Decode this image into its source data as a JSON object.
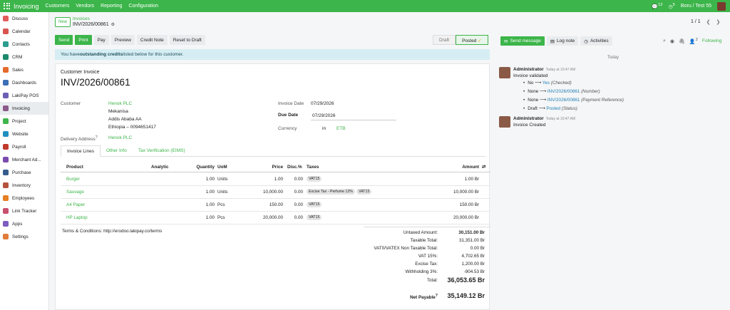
{
  "topbar": {
    "app_name": "Invoicing",
    "menus": [
      "Customers",
      "Vendors",
      "Reporting",
      "Configuration"
    ],
    "chat_count": "12",
    "activity_count": "5",
    "company": "Boru / Test 55"
  },
  "sidebar": {
    "items": [
      {
        "label": "Discuss",
        "color": "#e35c5c"
      },
      {
        "label": "Calendar",
        "color": "#d9534f"
      },
      {
        "label": "Contacts",
        "color": "#2a9d8f"
      },
      {
        "label": "CRM",
        "color": "#1b8a6b"
      },
      {
        "label": "Sales",
        "color": "#e46a2e"
      },
      {
        "label": "Dashboards",
        "color": "#3b6fb6"
      },
      {
        "label": "LakiPay POS",
        "color": "#6b5fb5"
      },
      {
        "label": "Invoicing",
        "color": "#8a5a8a",
        "active": true
      },
      {
        "label": "Project",
        "color": "#3cb54a"
      },
      {
        "label": "Website",
        "color": "#1f8fc0"
      },
      {
        "label": "Payroll",
        "color": "#c0392b"
      },
      {
        "label": "Merchant Ad...",
        "color": "#7b4bb0"
      },
      {
        "label": "Purchase",
        "color": "#355c8c"
      },
      {
        "label": "Inventory",
        "color": "#b5533c"
      },
      {
        "label": "Employees",
        "color": "#e67e22"
      },
      {
        "label": "Link Tracker",
        "color": "#c94f6d"
      },
      {
        "label": "Apps",
        "color": "#7c5cbf"
      },
      {
        "label": "Settings",
        "color": "#e07b39"
      }
    ]
  },
  "control_panel": {
    "new_label": "New",
    "breadcrumb_parent": "Invoices",
    "breadcrumb_current": "INV/2026/00861",
    "pager": "1 / 1"
  },
  "actions": [
    "Send",
    "Print",
    "Pay",
    "Preview",
    "Credit Note",
    "Reset to Draft"
  ],
  "status_stages": [
    "Draft",
    "Posted"
  ],
  "alert_prefix": "You have ",
  "alert_bold": "outstanding credits",
  "alert_suffix": " listed below for this customer.",
  "invoice": {
    "kind": "Customer Invoice",
    "name": "INV/2026/00861",
    "customer_label": "Customer",
    "customer_name": "Henok PLC",
    "address_1": "Mekanisa",
    "address_2": "Addis Ababa AA",
    "address_3": "Ethiopia – 0094651417",
    "delivery_label": "Delivery Address",
    "delivery_help": "?",
    "delivery_value": "Henok PLC",
    "invoice_date_label": "Invoice Date",
    "invoice_date": "07/29/2026",
    "due_date_label": "Due Date",
    "due_date": "07/29/2026",
    "currency_label": "Currency",
    "currency_in": "in",
    "currency": "ETB"
  },
  "tabs": [
    "Invoice Lines",
    "Other Info",
    "Tax Verification (EIMS)"
  ],
  "table": {
    "headers": {
      "product": "Product",
      "analytic": "Analytic",
      "quantity": "Quantity",
      "uom": "UoM",
      "price": "Price",
      "disc": "Disc.%",
      "taxes": "Taxes",
      "amount": "Amount"
    },
    "rows": [
      {
        "product": "Burger",
        "quantity": "1.00",
        "uom": "Units",
        "price": "1.00",
        "disc": "0.00",
        "taxes": [
          "VAT15"
        ],
        "amount": "1.00 Br"
      },
      {
        "product": "Sauvage",
        "quantity": "1.00",
        "uom": "Units",
        "price": "10,000.00",
        "disc": "0.00",
        "taxes": [
          "Excise Tax - Perfume 12%",
          "VAT15"
        ],
        "amount": "10,000.00 Br"
      },
      {
        "product": "A4 Paper",
        "quantity": "1.00",
        "uom": "Pcs",
        "price": "150.00",
        "disc": "0.00",
        "taxes": [
          "VAT15"
        ],
        "amount": "150.00 Br"
      },
      {
        "product": "HP Laptop",
        "quantity": "1.00",
        "uom": "Pcs",
        "price": "20,000.00",
        "disc": "0.00",
        "taxes": [
          "VAT15"
        ],
        "amount": "20,000.00 Br"
      }
    ]
  },
  "terms": "Terms & Conditions: http://erodoo.lakipay.co/terms",
  "totals": [
    {
      "label": "Untaxed Amount:",
      "value": "30,151.00 Br"
    },
    {
      "label": "Taxable Total:",
      "value": "31,351.00 Br"
    },
    {
      "label": "VAT0/VATEX Non Taxable Total:",
      "value": "0.00 Br"
    },
    {
      "label": "VAT 15%:",
      "value": "4,702.65 Br"
    },
    {
      "label": "Excise Tax:",
      "value": "1,200.00 Br"
    },
    {
      "label": "Withholding 3%:",
      "value": "-904.53 Br"
    },
    {
      "label": "Total:",
      "value": "36,053.65 Br"
    },
    {
      "label": "Net Payable",
      "value": "35,149.12 Br"
    }
  ],
  "chatter": {
    "send_message": "Send message",
    "log_note": "Log note",
    "activities": "Activities",
    "followers_count": "2",
    "following": "Following",
    "today": "Today",
    "messages": [
      {
        "author": "Administrator",
        "time": "Today at 10:47 AM",
        "body": "Invoice validated",
        "tracking": [
          {
            "old": "No",
            "new": "Yes",
            "field": "(Checked)"
          },
          {
            "old": "None",
            "new": "INV/2026/00861",
            "field": "(Number)"
          },
          {
            "old": "None",
            "new": "INV/2026/00861",
            "field": "(Payment Reference)"
          },
          {
            "old": "Draft",
            "new": "Posted",
            "field": "(Status)"
          }
        ]
      },
      {
        "author": "Administrator",
        "time": "Today at 10:47 AM",
        "body": "Invoice Created"
      }
    ]
  },
  "colors": {
    "brand": "#3cb54a",
    "alert_bg": "#d6eef3",
    "link": "#3cb54a",
    "tracking_link": "#1f7fb5"
  }
}
